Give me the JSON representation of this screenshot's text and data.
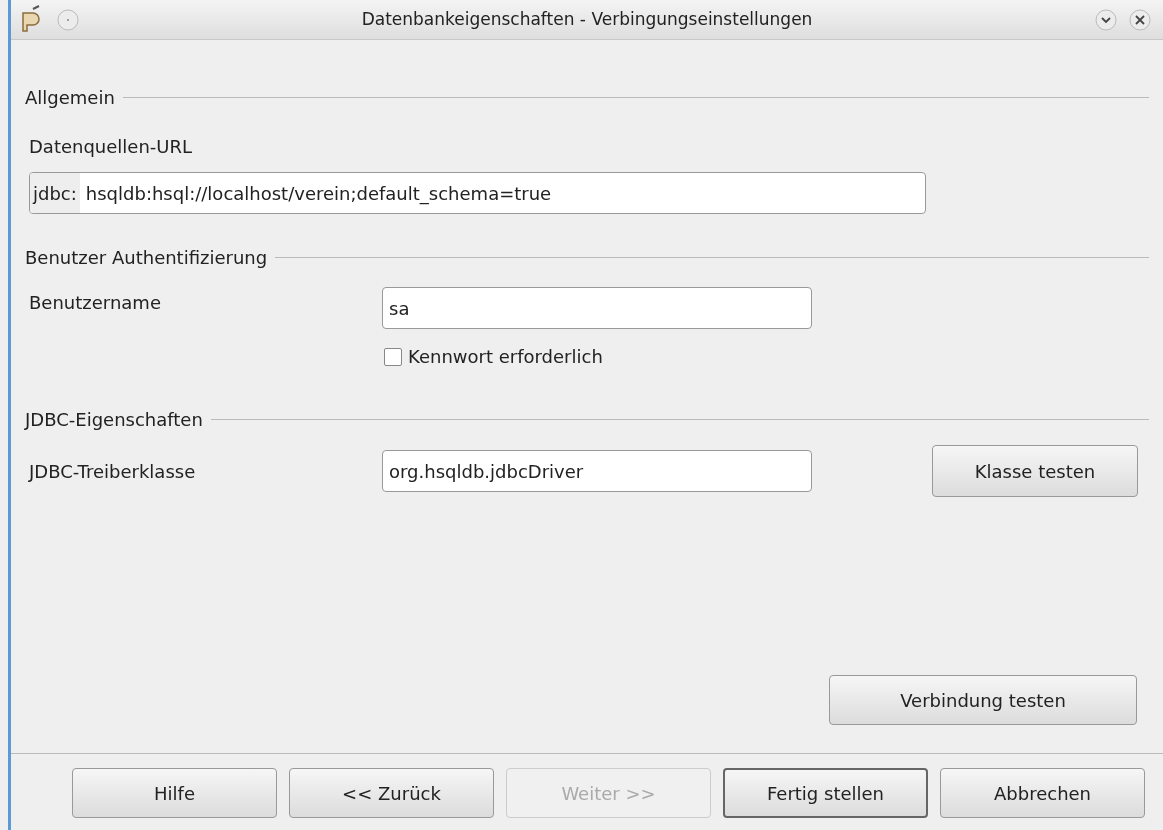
{
  "window": {
    "title": "Datenbankeigenschaften - Verbingungseinstellungen"
  },
  "general": {
    "heading": "Allgemein",
    "url_label": "Datenquellen-URL",
    "url_prefix": "jdbc:",
    "url_value": "hsqldb:hsql://localhost/verein;default_schema=true"
  },
  "auth": {
    "heading": "Benutzer Authentifizierung",
    "user_label": "Benutzername",
    "user_value": "sa",
    "password_required": {
      "label": "Kennwort erforderlich",
      "checked": false
    }
  },
  "jdbc": {
    "heading": "JDBC-Eigenschaften",
    "driver_label": "JDBC-Treiberklasse",
    "driver_value": "org.hsqldb.jdbcDriver",
    "test_class_button": "Klasse testen"
  },
  "test_connection_button": "Verbindung testen",
  "buttons": [
    {
      "label": "Hilfe",
      "disabled": false,
      "default": false
    },
    {
      "label": "<< Zurück",
      "disabled": false,
      "default": false
    },
    {
      "label": "Weiter >>",
      "disabled": true,
      "default": false
    },
    {
      "label": "Fertig stellen",
      "disabled": false,
      "default": true
    },
    {
      "label": "Abbrechen",
      "disabled": false,
      "default": false
    }
  ]
}
